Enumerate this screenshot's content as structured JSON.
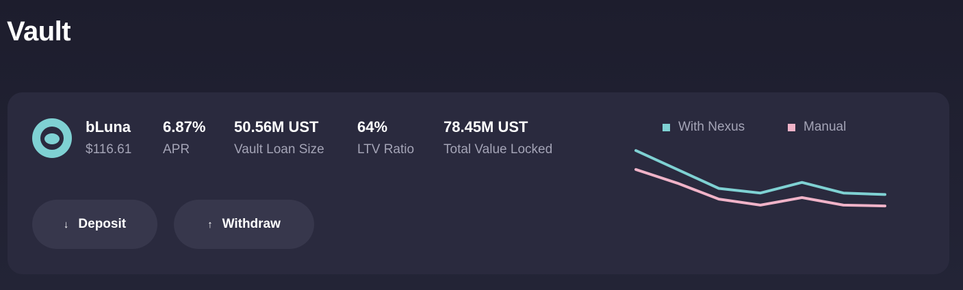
{
  "page": {
    "title": "Vault"
  },
  "vault": {
    "token_name": "bLuna",
    "token_price": "$116.61",
    "token_icon": "luna-token-icon",
    "stats": [
      {
        "value": "6.87%",
        "label": "APR"
      },
      {
        "value": "50.56M UST",
        "label": "Vault Loan Size"
      },
      {
        "value": "64%",
        "label": "LTV Ratio"
      },
      {
        "value": "78.45M UST",
        "label": "Total Value Locked"
      }
    ],
    "buttons": {
      "deposit_label": "Deposit",
      "deposit_icon": "arrow-down-icon",
      "withdraw_label": "Withdraw",
      "withdraw_icon": "arrow-up-icon"
    }
  },
  "colors": {
    "accent_teal": "#7fd1d3",
    "accent_pink": "#f0b3c8",
    "card_bg": "#2a2a3e",
    "button_bg": "#37374c"
  },
  "chart_data": {
    "type": "line",
    "x": [
      1,
      2,
      3,
      4,
      5,
      6,
      7
    ],
    "series": [
      {
        "name": "With Nexus",
        "color": "#7fd1d3",
        "values": [
          100,
          75,
          50,
          44,
          58,
          44,
          42
        ]
      },
      {
        "name": "Manual",
        "color": "#f0b3c8",
        "values": [
          75,
          57,
          36,
          28,
          38,
          28,
          27
        ]
      }
    ],
    "ylim": [
      0,
      110
    ],
    "legend": "top-center",
    "grid": false
  }
}
